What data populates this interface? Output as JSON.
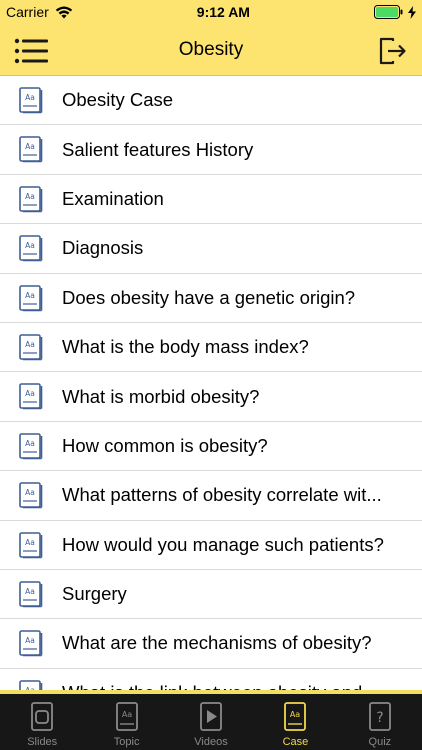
{
  "status_bar": {
    "carrier": "Carrier",
    "time": "9:12 AM"
  },
  "header": {
    "title": "Obesity"
  },
  "list": {
    "items": [
      {
        "label": "Obesity Case"
      },
      {
        "label": "Salient features History"
      },
      {
        "label": "Examination"
      },
      {
        "label": "Diagnosis"
      },
      {
        "label": "Does obesity have a genetic origin?"
      },
      {
        "label": "What is the body mass index?"
      },
      {
        "label": "What is morbid obesity?"
      },
      {
        "label": "How common is obesity?"
      },
      {
        "label": "What patterns of obesity correlate wit..."
      },
      {
        "label": "How would you manage such patients?"
      },
      {
        "label": "Surgery"
      },
      {
        "label": "What are the mechanisms of obesity?"
      },
      {
        "label": "What is the link between obesity and..."
      }
    ]
  },
  "tab_bar": {
    "tabs": [
      {
        "label": "Slides",
        "icon": "slides-icon"
      },
      {
        "label": "Topic",
        "icon": "topic-icon"
      },
      {
        "label": "Videos",
        "icon": "videos-icon"
      },
      {
        "label": "Case",
        "icon": "case-icon"
      },
      {
        "label": "Quiz",
        "icon": "quiz-icon"
      }
    ],
    "active_index": 3
  },
  "colors": {
    "header_bg": "#FDE370",
    "tab_bar_bg": "#171717",
    "active_tab": "#F2D84B",
    "inactive_tab": "#8a8a8a",
    "icon_blue": "#3f5f93"
  }
}
